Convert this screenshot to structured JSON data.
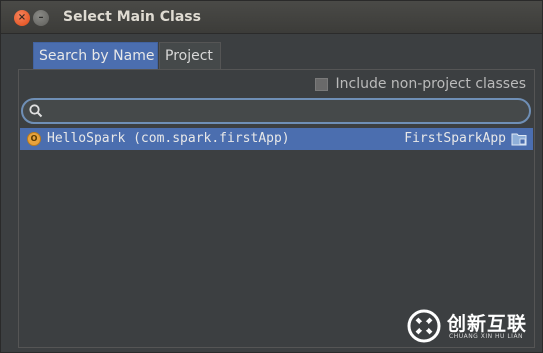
{
  "window": {
    "title": "Select Main Class",
    "close_icon": "close-icon",
    "minimize_icon": "minimize-icon"
  },
  "tabs": [
    {
      "label": "Search by Name",
      "active": true
    },
    {
      "label": "Project",
      "active": false
    }
  ],
  "options": {
    "include_non_project_label": "Include non-project classes",
    "include_non_project_checked": false
  },
  "search": {
    "value": "",
    "placeholder": "",
    "icon": "search-icon"
  },
  "results": [
    {
      "icon": "class-icon",
      "icon_glyph": "O",
      "class_name": "HelloSpark (com.spark.firstApp)",
      "module": "FirstSparkApp",
      "module_icon": "module-folder-icon",
      "selected": true
    }
  ],
  "watermark": {
    "brand_cn": "创新互联",
    "brand_en": "CHUANG XIN HU LIAN"
  },
  "colors": {
    "background": "#3c3f41",
    "selection": "#4b6eaf",
    "search_border": "#6f8fb6",
    "close_button": "#e95420"
  }
}
